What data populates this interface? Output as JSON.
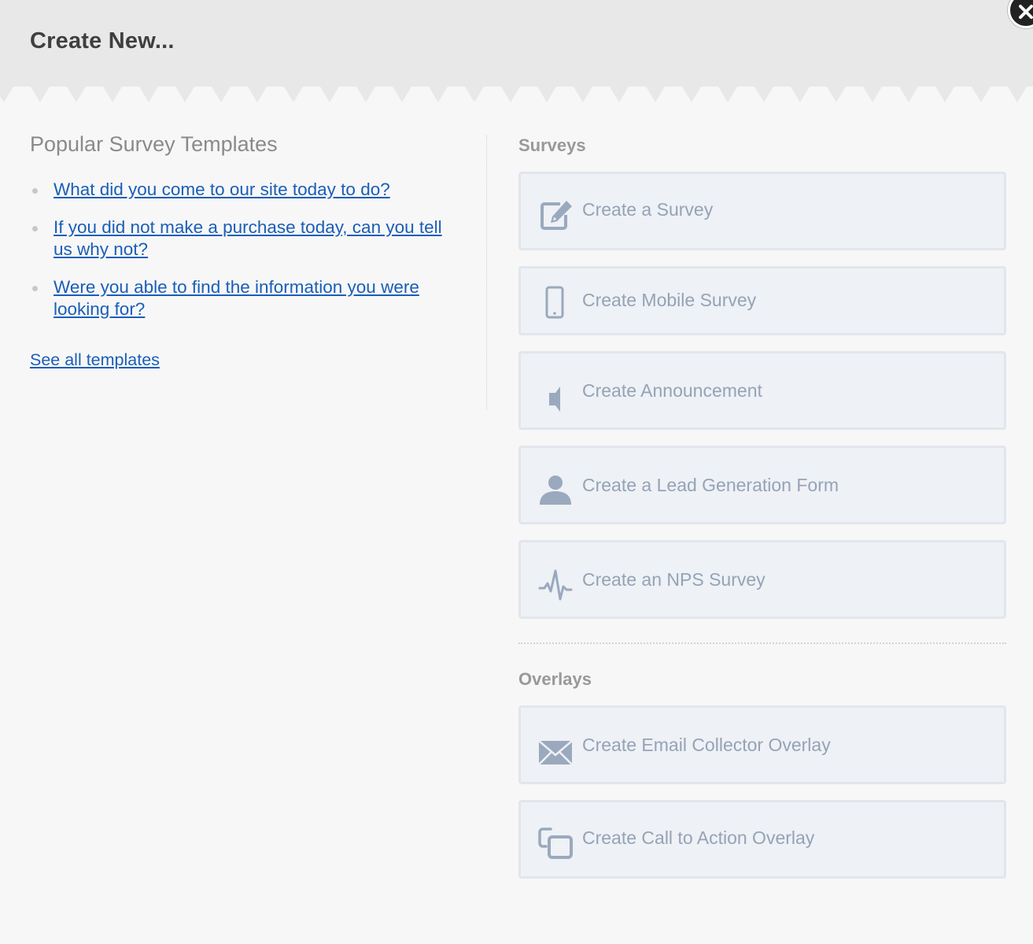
{
  "dialog": {
    "title": "Create New...",
    "close_icon": "close-icon"
  },
  "templates": {
    "title": "Popular Survey Templates",
    "items": [
      {
        "label": "What did you come to our site today to do?"
      },
      {
        "label": "If you did not make a purchase today, can you tell us why not?"
      },
      {
        "label": "Were you able to find the information you were looking for?"
      }
    ],
    "see_all": "See all templates"
  },
  "surveys": {
    "title": "Surveys",
    "options": [
      {
        "label": "Create a Survey",
        "icon": "edit-icon"
      },
      {
        "label": "Create Mobile Survey",
        "icon": "mobile-icon"
      },
      {
        "label": "Create Announcement",
        "icon": "megaphone-icon"
      },
      {
        "label": "Create a Lead Generation Form",
        "icon": "person-icon"
      },
      {
        "label": "Create an NPS Survey",
        "icon": "pulse-icon"
      }
    ]
  },
  "overlays": {
    "title": "Overlays",
    "options": [
      {
        "label": "Create Email Collector Overlay",
        "icon": "envelope-icon"
      },
      {
        "label": "Create Call to Action Overlay",
        "icon": "overlay-windows-icon"
      }
    ]
  },
  "colors": {
    "header_bg": "#e8e8e8",
    "body_bg": "#f7f7f7",
    "link": "#1a5eb8",
    "option_bg": "#eef1f5",
    "option_border": "#e2e6ec",
    "option_text": "#95a3b6",
    "icon": "#9aa9bd"
  }
}
